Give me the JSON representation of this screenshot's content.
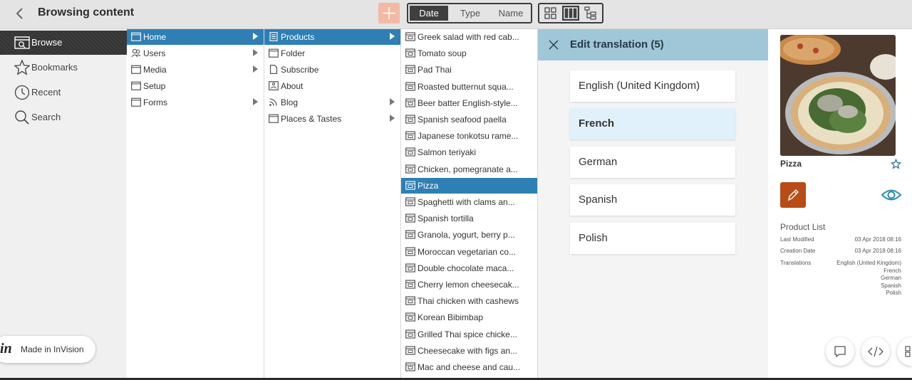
{
  "header": {
    "title": "Browsing content",
    "sort_options": [
      "Date",
      "Type",
      "Name"
    ],
    "sort_active": "Date",
    "colors": {
      "add_button": "#f3b9a3",
      "selection": "#2e7fb4"
    }
  },
  "sidebar": {
    "items": [
      {
        "label": "Browse",
        "icon": "browse-icon",
        "active": true
      },
      {
        "label": "Bookmarks",
        "icon": "star-icon"
      },
      {
        "label": "Recent",
        "icon": "clock-icon"
      },
      {
        "label": "Search",
        "icon": "search-icon"
      }
    ],
    "badge": {
      "logo": "in",
      "text": "Made in InVision"
    }
  },
  "columns": {
    "col1": [
      {
        "label": "Home",
        "icon": "folder-icon",
        "selected": true,
        "has_children": true
      },
      {
        "label": "Users",
        "icon": "users-icon",
        "has_children": true
      },
      {
        "label": "Media",
        "icon": "folder-icon",
        "has_children": true
      },
      {
        "label": "Setup",
        "icon": "folder-icon"
      },
      {
        "label": "Forms",
        "icon": "folder-icon",
        "has_children": true
      }
    ],
    "col2": [
      {
        "label": "Products",
        "icon": "product-icon",
        "selected": true,
        "has_children": true
      },
      {
        "label": "Folder",
        "icon": "folder-icon"
      },
      {
        "label": "Subscribe",
        "icon": "page-icon"
      },
      {
        "label": "About",
        "icon": "about-icon"
      },
      {
        "label": "Blog",
        "icon": "rss-icon",
        "has_children": true
      },
      {
        "label": "Places & Tastes",
        "icon": "folder-icon",
        "has_children": true
      }
    ],
    "col3": [
      {
        "label": "Greek salad with red cab..."
      },
      {
        "label": "Tomato soup"
      },
      {
        "label": "Pad Thai"
      },
      {
        "label": "Roasted butternut squa..."
      },
      {
        "label": "Beer batter English-style..."
      },
      {
        "label": "Spanish seafood paella"
      },
      {
        "label": "Japanese tonkotsu rame..."
      },
      {
        "label": "Salmon teriyaki"
      },
      {
        "label": "Chicken, pomegranate a..."
      },
      {
        "label": "Pizza",
        "selected": true
      },
      {
        "label": "Spaghetti with clams an..."
      },
      {
        "label": "Spanish tortilla"
      },
      {
        "label": "Granola, yogurt, berry p..."
      },
      {
        "label": "Moroccan vegetarian co..."
      },
      {
        "label": "Double chocolate maca..."
      },
      {
        "label": "Cherry lemon cheesecak..."
      },
      {
        "label": "Thai chicken with cashews"
      },
      {
        "label": "Korean Bibimbap"
      },
      {
        "label": "Grilled Thai spice chicke..."
      },
      {
        "label": "Cheesecake with figs an..."
      },
      {
        "label": "Mac and cheese and cau..."
      }
    ]
  },
  "panel": {
    "title": "Edit translation (5)",
    "languages": [
      {
        "label": "English (United Kingdom)"
      },
      {
        "label": "French",
        "active": true
      },
      {
        "label": "German"
      },
      {
        "label": "Spanish"
      },
      {
        "label": "Polish"
      }
    ]
  },
  "detail": {
    "title": "Pizza",
    "section": "Product List",
    "meta": [
      {
        "key": "Last Modified",
        "value": "03 Apr 2018 08:16"
      },
      {
        "key": "Creation Date",
        "value": "03 Apr 2018 08:16"
      },
      {
        "key": "Translations",
        "value": "English (United Kingdom)\nFrench\nGerman\nSpanish\nPolish"
      }
    ],
    "colors": {
      "edit_button": "#b94b17",
      "eye": "#2a8fb5"
    }
  }
}
